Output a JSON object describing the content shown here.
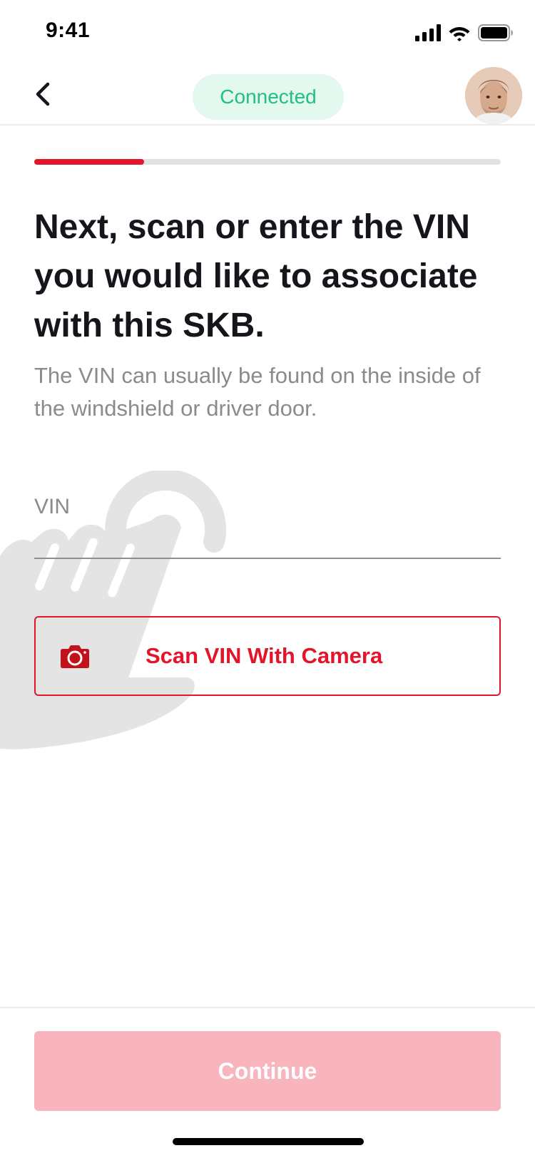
{
  "status_bar": {
    "time": "9:41"
  },
  "nav": {
    "connection_status": "Connected"
  },
  "progress": {
    "fraction": 0.235
  },
  "content": {
    "title": "Next, scan or enter the VIN you would like to associate with this SKB.",
    "subtitle": "The VIN can usually be found on the inside of the windshield or driver door."
  },
  "vin_field": {
    "label": "VIN",
    "value": ""
  },
  "scan_button": {
    "label": "Scan VIN With Camera",
    "icon": "camera-icon"
  },
  "footer": {
    "continue_label": "Continue"
  },
  "colors": {
    "accent": "#e3152b",
    "connected_bg": "#e3f8ef",
    "connected_text": "#21c07e",
    "disabled_button": "#f8b5bd"
  }
}
